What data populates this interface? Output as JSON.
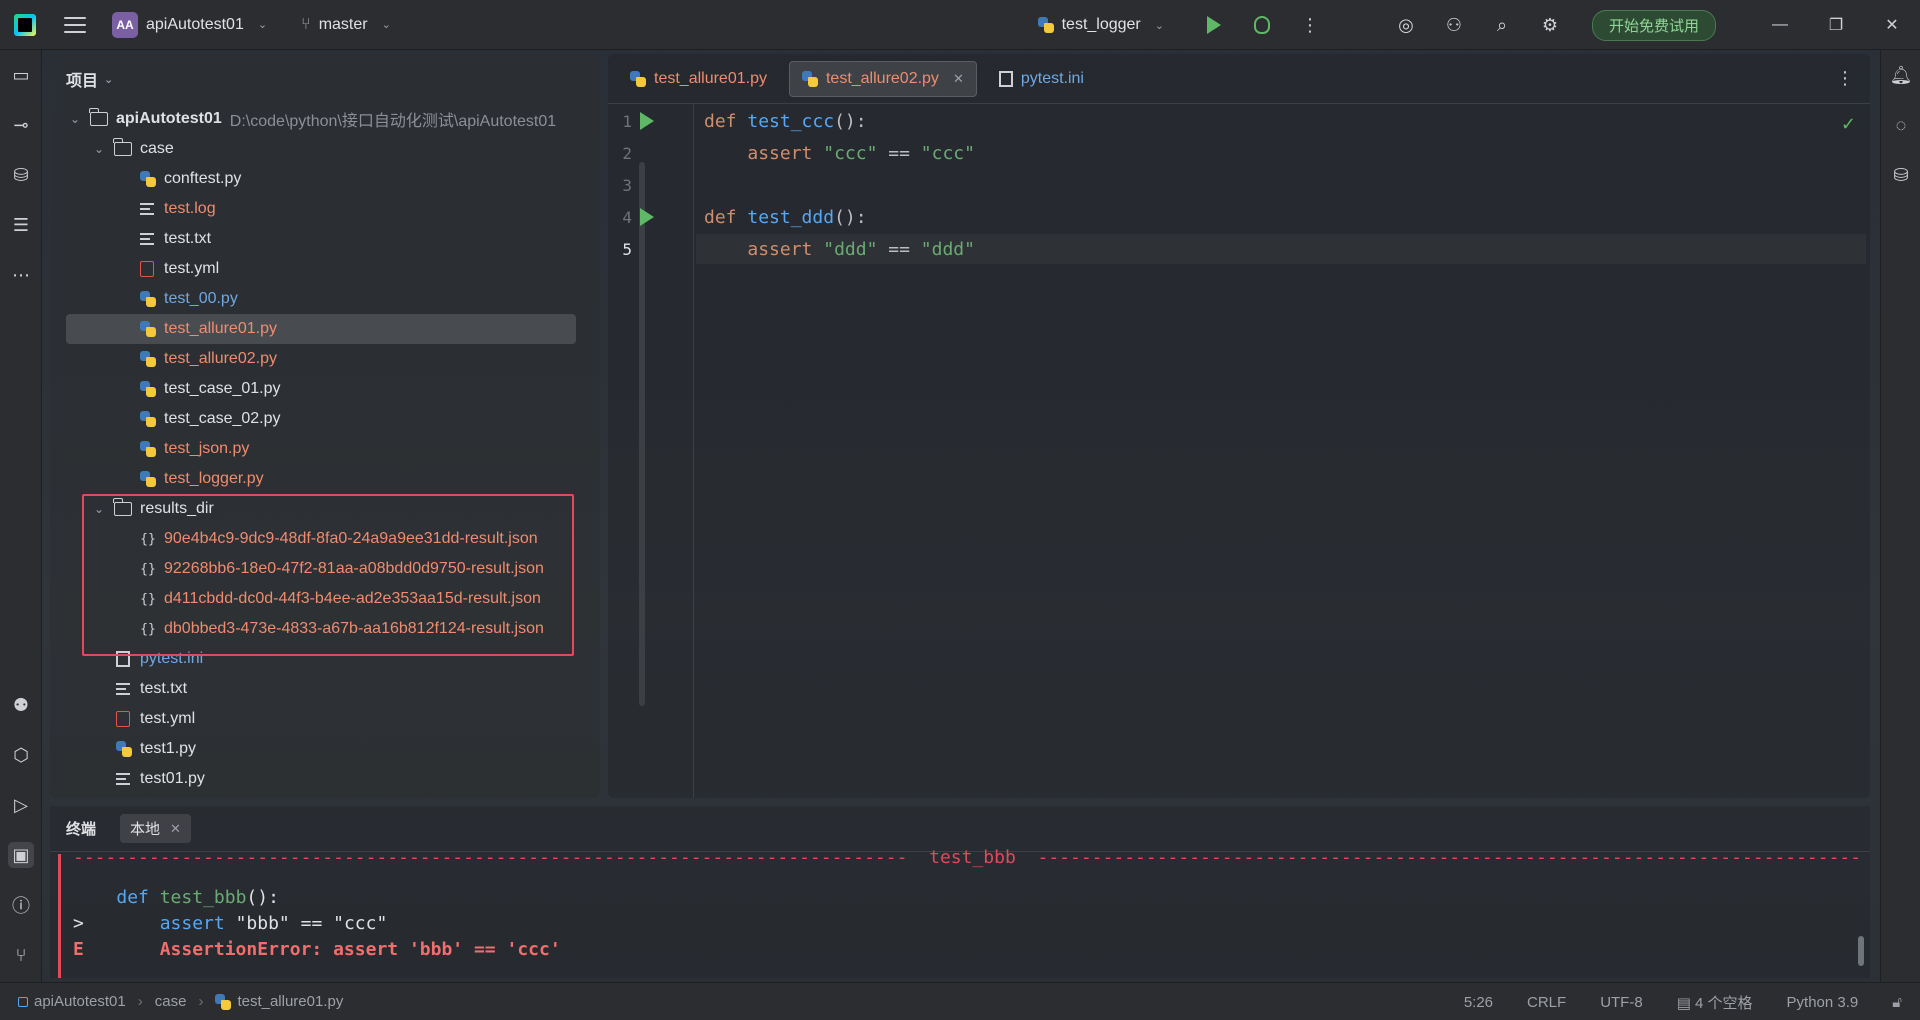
{
  "titlebar": {
    "project_badge": "AA",
    "project_name": "apiAutotest01",
    "branch": "master",
    "run_config": "test_logger",
    "trial_button": "开始免费试用",
    "minimize": "—",
    "restore": "❐",
    "close": "✕"
  },
  "project_panel": {
    "title": "项目",
    "tree": [
      {
        "name": "apiAutotest01",
        "path": "D:\\code\\python\\接口自动化测试\\apiAutotest01"
      },
      {
        "name": "case"
      },
      {
        "name": "conftest.py"
      },
      {
        "name": "test.log"
      },
      {
        "name": "test.txt"
      },
      {
        "name": "test.yml"
      },
      {
        "name": "test_00.py"
      },
      {
        "name": "test_allure01.py"
      },
      {
        "name": "test_allure02.py"
      },
      {
        "name": "test_case_01.py"
      },
      {
        "name": "test_case_02.py"
      },
      {
        "name": "test_json.py"
      },
      {
        "name": "test_logger.py"
      },
      {
        "name": "results_dir"
      },
      {
        "name": "90e4b4c9-9dc9-48df-8fa0-24a9a9ee31dd-result.json"
      },
      {
        "name": "92268bb6-18e0-47f2-81aa-a08bdd0d9750-result.json"
      },
      {
        "name": "d411cbdd-dc0d-44f3-b4ee-ad2e353aa15d-result.json"
      },
      {
        "name": "db0bbed3-473e-4833-a67b-aa16b812f124-result.json"
      },
      {
        "name": "pytest.ini"
      },
      {
        "name": "test.txt"
      },
      {
        "name": "test.yml"
      },
      {
        "name": "test1.py"
      },
      {
        "name": "test01.py"
      }
    ]
  },
  "editor": {
    "tabs": [
      {
        "label": "test_allure01.py"
      },
      {
        "label": "test_allure02.py"
      },
      {
        "label": "pytest.ini"
      }
    ],
    "line_numbers": [
      "1",
      "2",
      "3",
      "4",
      "5"
    ],
    "code": {
      "l1_kw": "def",
      "l1_fn": "test_ccc",
      "l1_rest": "():",
      "l2_kw": "assert",
      "l2_a": "\"ccc\"",
      "l2_op": " == ",
      "l2_b": "\"ccc\"",
      "l4_kw": "def",
      "l4_fn": "test_ddd",
      "l4_rest": "():",
      "l5_kw": "assert",
      "l5_a": "\"ddd\"",
      "l5_op": " == ",
      "l5_b": "\"ddd\""
    }
  },
  "terminal": {
    "title": "终端",
    "tab_label": "本地",
    "separator_text": "test_bbb",
    "line1_kw": "def",
    "line1_fn": "test_bbb",
    "line1_rest": "():",
    "line2_prefix": ">",
    "line2_kw": "assert",
    "line2_a": "\"bbb\"",
    "line2_op": " == ",
    "line2_b": "\"ccc\"",
    "line3_prefix": "E",
    "line3_text": "AssertionError: assert 'bbb' == 'ccc'"
  },
  "statusbar": {
    "crumbs": [
      "apiAutotest01",
      "case",
      "test_allure01.py"
    ],
    "position": "5:26",
    "line_ending": "CRLF",
    "encoding": "UTF-8",
    "indent": "4 个空格",
    "interpreter": "Python 3.9"
  }
}
